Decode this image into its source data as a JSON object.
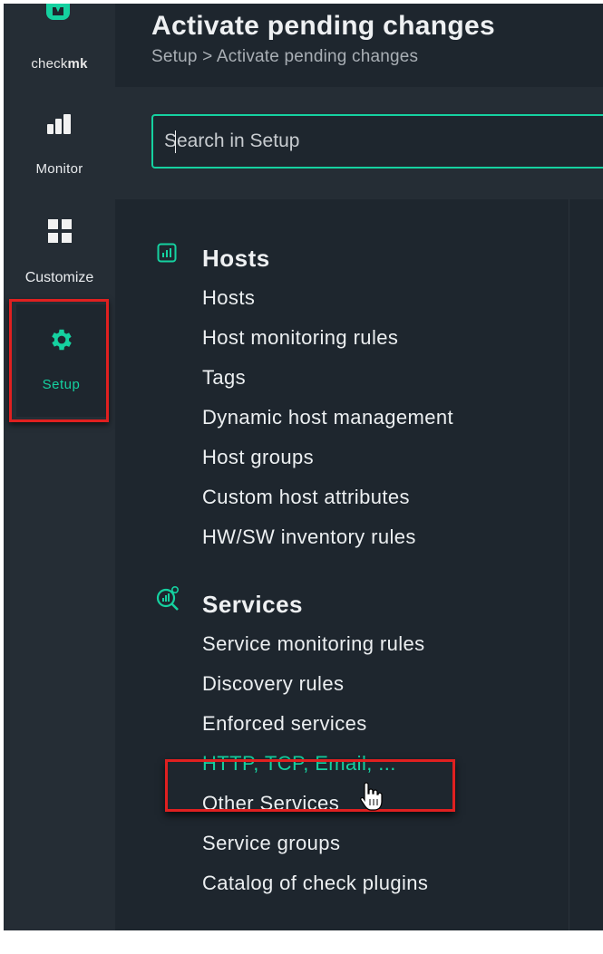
{
  "brand": {
    "name_prefix": "check",
    "name_bold": "mk"
  },
  "nav": {
    "monitor": "Monitor",
    "customize": "Customize",
    "setup": "Setup"
  },
  "header": {
    "title": "Activate pending changes",
    "breadcrumb": "Setup > Activate pending changes"
  },
  "search": {
    "placeholder": "Search in Setup",
    "value": ""
  },
  "sections": {
    "hosts": {
      "title": "Hosts",
      "items": [
        "Hosts",
        "Host monitoring rules",
        "Tags",
        "Dynamic host management",
        "Host groups",
        "Custom host attributes",
        "HW/SW inventory rules"
      ]
    },
    "services": {
      "title": "Services",
      "items": [
        "Service monitoring rules",
        "Discovery rules",
        "Enforced services",
        "HTTP, TCP, Email, ...",
        "Other Services",
        "Service groups",
        "Catalog of check plugins"
      ]
    }
  },
  "colors": {
    "accent": "#15d1a0",
    "highlight": "#e02020",
    "background": "#1e262e",
    "nav_background": "#252d35"
  },
  "icons": {
    "logo": "checkmk-logo",
    "monitor": "bar-chart-icon",
    "customize": "grid-icon",
    "setup": "gear-icon",
    "hosts": "host-icon",
    "services": "service-search-icon",
    "cursor": "hand-pointer-icon"
  }
}
